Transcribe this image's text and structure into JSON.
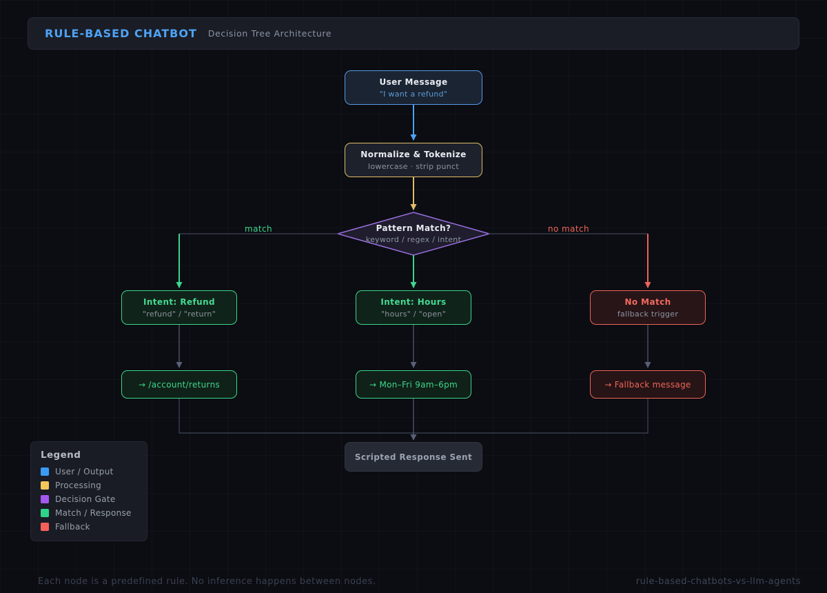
{
  "header": {
    "title": "RULE-BASED CHATBOT",
    "subtitle": "Decision Tree Architecture"
  },
  "nodes": {
    "user_message": {
      "title": "User Message",
      "subtitle": "\"I want a refund\""
    },
    "normalize": {
      "title": "Normalize & Tokenize",
      "subtitle": "lowercase · strip punct"
    },
    "pattern_match": {
      "title": "Pattern Match?",
      "subtitle": "keyword / regex / intent"
    },
    "intent_refund": {
      "title": "Intent: Refund",
      "subtitle": "\"refund\" / \"return\""
    },
    "intent_hours": {
      "title": "Intent: Hours",
      "subtitle": "\"hours\" / \"open\""
    },
    "no_match": {
      "title": "No Match",
      "subtitle": "fallback trigger"
    },
    "response_refund": {
      "label": "→ /account/returns"
    },
    "response_hours": {
      "label": "→ Mon–Fri 9am–6pm"
    },
    "response_fallback": {
      "label": "→ Fallback message"
    },
    "scripted_response": {
      "label": "Scripted Response Sent"
    }
  },
  "edges": {
    "match_label": "match",
    "no_match_label": "no match"
  },
  "legend": {
    "title": "Legend",
    "items": [
      {
        "label": "User / Output",
        "color": "#3b9cf5"
      },
      {
        "label": "Processing",
        "color": "#f5c65a"
      },
      {
        "label": "Decision Gate",
        "color": "#a257ee"
      },
      {
        "label": "Match / Response",
        "color": "#2ed589"
      },
      {
        "label": "Fallback",
        "color": "#f7605a"
      }
    ]
  },
  "footer": {
    "note": "Each node is a predefined rule. No inference happens between nodes.",
    "slug": "rule-based-chatbots-vs-llm-agents"
  },
  "colors": {
    "accent_blue": "#4da3f5",
    "accent_amber": "#e2bd69",
    "accent_purple": "#9b6fe0",
    "accent_green": "#3dd68c",
    "accent_red": "#ef6459",
    "connector_gray": "#4c5268"
  }
}
